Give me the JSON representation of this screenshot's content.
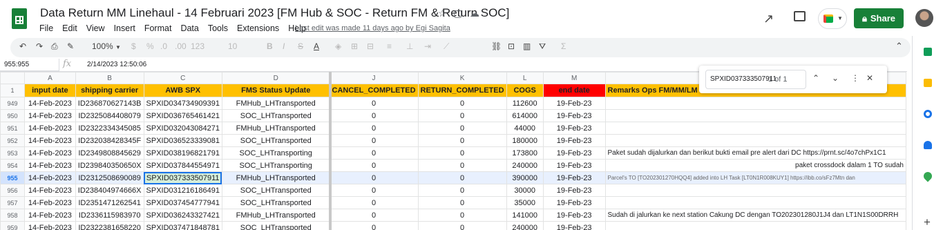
{
  "title": "Data Return MM Linehaul - 14 Februari 2023 [FM Hub & SOC - Return FM & Return SOC]",
  "menu": [
    "File",
    "Edit",
    "View",
    "Insert",
    "Format",
    "Data",
    "Tools",
    "Extensions",
    "Help"
  ],
  "last_edit": "Last edit was made 11 days ago by Egi Sagita",
  "share_label": "Share",
  "toolbar": {
    "zoom": "100%",
    "font_size": "10",
    "currency": "$",
    "percent": "%",
    "dec_less": ".0",
    "dec_more": ".00",
    "format_more": "123"
  },
  "name_box": "955:955",
  "formula": "2/14/2023 12:50:06",
  "find": {
    "query": "SPXID037333507911",
    "count": "1 of 1"
  },
  "columns": [
    "A",
    "B",
    "C",
    "D",
    "J",
    "K",
    "L",
    "M"
  ],
  "header_row_num": "1",
  "headers": [
    "input date",
    "shipping carrier",
    "AWB SPX",
    "FMS Status Update",
    "CANCEL_COMPLETED",
    "RETURN_COMPLETED",
    "COGS",
    "end date",
    "Remarks Ops FM/MM/LM"
  ],
  "rows": [
    {
      "n": "949",
      "c": [
        "14-Feb-2023",
        "ID236870627143B",
        "SPXID034734909391",
        "FMHub_LHTransported",
        "0",
        "0",
        "112600",
        "19-Feb-23",
        ""
      ]
    },
    {
      "n": "950",
      "c": [
        "14-Feb-2023",
        "ID2325084408079",
        "SPXID036765461421",
        "SOC_LHTransported",
        "0",
        "0",
        "614000",
        "19-Feb-23",
        ""
      ]
    },
    {
      "n": "951",
      "c": [
        "14-Feb-2023",
        "ID2322334345085",
        "SPXID032043084271",
        "FMHub_LHTransported",
        "0",
        "0",
        "44000",
        "19-Feb-23",
        ""
      ]
    },
    {
      "n": "952",
      "c": [
        "14-Feb-2023",
        "ID232038428345F",
        "SPXID036523339081",
        "SOC_LHTransported",
        "0",
        "0",
        "180000",
        "19-Feb-23",
        ""
      ]
    },
    {
      "n": "953",
      "c": [
        "14-Feb-2023",
        "ID2349808845629",
        "SPXID038196821791",
        "SOC_LHTransporting",
        "0",
        "0",
        "173800",
        "19-Feb-23",
        "Paket sudah dijalurkan dan berikut bukti email pre alert dari DC https://prnt.sc/4o7chPx1C1"
      ]
    },
    {
      "n": "954",
      "c": [
        "14-Feb-2023",
        "ID239840350650X",
        "SPXID037844554971",
        "SOC_LHTransporting",
        "0",
        "0",
        "240000",
        "19-Feb-23",
        "paket crossdock dalam 1 TO sudah"
      ]
    },
    {
      "n": "955",
      "c": [
        "14-Feb-2023",
        "ID2312508690089",
        "SPXID037333507911",
        "FMHub_LHTransported",
        "0",
        "0",
        "390000",
        "19-Feb-23",
        "Parcel's TO [TO202301270HQQ4] added into LH Task [LT0N1R008KUY1] https://ibb.co/sFz7Mtn dan"
      ]
    },
    {
      "n": "956",
      "c": [
        "14-Feb-2023",
        "ID238404974666X",
        "SPXID031216186491",
        "SOC_LHTransported",
        "0",
        "0",
        "30000",
        "19-Feb-23",
        ""
      ]
    },
    {
      "n": "957",
      "c": [
        "14-Feb-2023",
        "ID2351471262541",
        "SPXID037454777941",
        "SOC_LHTransported",
        "0",
        "0",
        "35000",
        "19-Feb-23",
        ""
      ]
    },
    {
      "n": "958",
      "c": [
        "14-Feb-2023",
        "ID2336115983970",
        "SPXID036243327421",
        "FMHub_LHTransported",
        "0",
        "0",
        "141000",
        "19-Feb-23",
        "Sudah di jalurkan ke next station Cakung DC dengan TO202301280J1J4 dan LT1N1S00DRRH"
      ]
    },
    {
      "n": "959",
      "c": [
        "14-Feb-2023",
        "ID2322381658220",
        "SPXID037471848781",
        "SOC_LHTransported",
        "0",
        "0",
        "240000",
        "19-Feb-23",
        ""
      ]
    }
  ]
}
